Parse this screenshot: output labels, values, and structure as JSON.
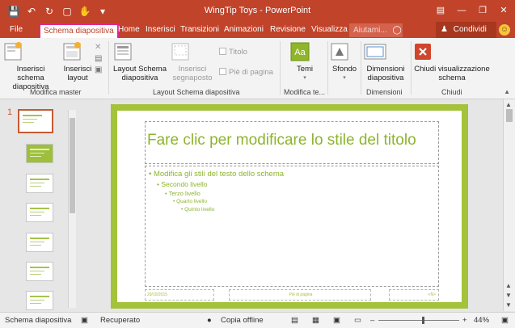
{
  "window": {
    "title": "WingTip Toys - PowerPoint",
    "qat_icons": [
      "save-icon",
      "undo-icon",
      "redo-icon",
      "present-from-start-icon",
      "touch-mode-icon",
      "customize-qat-icon"
    ],
    "controls": [
      "ribbon-display-options-icon",
      "minimize-icon",
      "restore-icon",
      "close-icon"
    ]
  },
  "tabs": [
    "File",
    "Schema diapositiva",
    "Home",
    "Inserisci",
    "Transizioni",
    "Animazioni",
    "Revisione",
    "Visualizza"
  ],
  "active_tab": "Schema diapositiva",
  "tell_me": "Aiutami...",
  "share": "Condividi",
  "ribbon": {
    "groups": {
      "modifica_master": "Modifica master",
      "layout_schema": "Layout Schema diapositiva",
      "modifica_tema": "Modifica te...",
      "dimensioni": "Dimensioni",
      "chiudi": "Chiudi"
    },
    "buttons": {
      "inserisci_schema": [
        "Inserisci schema",
        "diapositiva"
      ],
      "inserisci_layout": [
        "Inserisci",
        "layout"
      ],
      "layout_schema": [
        "Layout Schema",
        "diapositiva"
      ],
      "inserisci_segnaposto": [
        "Inserisci",
        "segnaposto"
      ],
      "temi": "Temi",
      "sfondo": "Sfondo",
      "dimensioni": [
        "Dimensioni",
        "diapositiva"
      ],
      "chiudi": [
        "Chiudi visualizzazione",
        "schema"
      ]
    },
    "checkboxes": {
      "titolo": "Titolo",
      "pie": "Piè di pagina"
    }
  },
  "thumbnails": {
    "selected_number": "1"
  },
  "slide": {
    "title": "Fare clic per modificare lo stile del titolo",
    "levels": [
      "Modifica gli stili del testo dello schema",
      "Secondo livello",
      "Terzo livello",
      "Quarto livello",
      "Quinto livello"
    ],
    "footer_date": "29/10/2015",
    "footer_center": "Piè di pagina",
    "footer_number": "<N>"
  },
  "status": {
    "view": "Schema diapositiva",
    "recovered": "Recuperato",
    "offline": "Copia offline",
    "zoom": "44%"
  },
  "colors": {
    "accent": "#c0432a",
    "slide_green": "#a4c23a",
    "text_green": "#8db42c",
    "highlight": "#e0268c"
  }
}
